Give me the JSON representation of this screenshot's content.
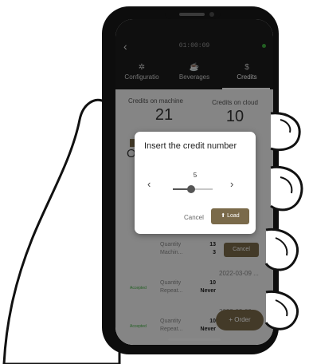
{
  "status_bar": {
    "time": "01:00:09"
  },
  "tabs": [
    {
      "label": "Configuratio",
      "icon": "gear-icon"
    },
    {
      "label": "Beverages",
      "icon": "coffee-icon"
    },
    {
      "label": "Credits",
      "icon": "dollar-icon"
    }
  ],
  "credits": {
    "machine_label": "Credits on machine",
    "machine_value": "21",
    "cloud_label": "Credits on cloud",
    "cloud_value": "10"
  },
  "section_heading": "O",
  "orders": [
    {
      "status": "",
      "line1": "Quantity",
      "line2": "Machin...",
      "val1": "13",
      "val2": "3",
      "date": "",
      "action": "Cancel"
    },
    {
      "status": "Accepted",
      "line1": "Quantity",
      "line2": "Repeat...",
      "val1": "10",
      "val2": "Never",
      "date": "2022-03-09 ...",
      "action": ""
    },
    {
      "status": "Accepted",
      "line1": "Quantity",
      "line2": "Repeat...",
      "val1": "10",
      "val2": "Never",
      "date": "2022-03-09",
      "action": ""
    }
  ],
  "order_button": "Order",
  "dialog": {
    "title": "Insert the credit number",
    "value": "5",
    "cancel": "Cancel",
    "load": "Load",
    "level": 0.45
  },
  "colors": {
    "accent": "#7a6a4a",
    "accepted": "#3fae3f",
    "topbar": "#1c1c1c"
  }
}
